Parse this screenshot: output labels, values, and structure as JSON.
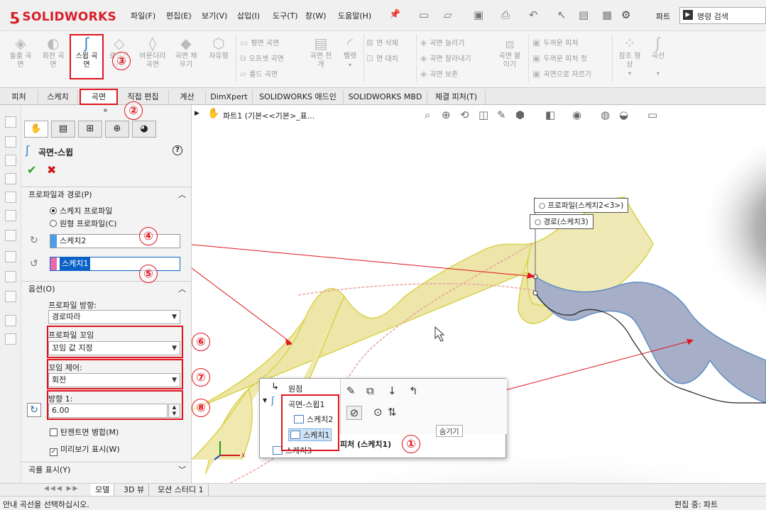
{
  "app": {
    "logo_text": "SOLIDWORKS",
    "part_label": "파트",
    "search_placeholder": "명령 검색"
  },
  "menu": [
    "파일(F)",
    "편집(E)",
    "보기(V)",
    "삽입(I)",
    "도구(T)",
    "창(W)",
    "도움말(H)"
  ],
  "ribbon": {
    "big": [
      {
        "label1": "돌출 곡",
        "label2": "면"
      },
      {
        "label1": "회전 곡",
        "label2": "면"
      },
      {
        "label1": "스윕 곡",
        "label2": "면"
      },
      {
        "label1": "로프트",
        "label2": "곡면"
      },
      {
        "label1": "바운더리",
        "label2": "곡면"
      },
      {
        "label1": "곡면 채",
        "label2": "우기"
      },
      {
        "label1": "자유형",
        "label2": ""
      }
    ],
    "col1": [
      "평면 곡면",
      "오프셋 곡면",
      "룰드 곡면"
    ],
    "col2a": {
      "label1": "곡면 전",
      "label2": "개"
    },
    "col2b": {
      "label1": "펠렛",
      "label2": ""
    },
    "col3": [
      "면 삭제",
      "면 대치"
    ],
    "col4": [
      "곡면 늘리기",
      "곡면 잘라내기",
      "곡면 보존"
    ],
    "col5": {
      "label1": "곡면 붙",
      "label2": "이기"
    },
    "col6": [
      "두꺼운 피처",
      "두꺼운 피처 컷",
      "곡면으로 자르기"
    ],
    "col7": {
      "label1": "참조 형",
      "label2": "상"
    },
    "col8": {
      "label1": "곡선",
      "label2": ""
    }
  },
  "tabs": [
    "피처",
    "스케치",
    "곡면",
    "직접 편집",
    "계산",
    "DimXpert",
    "SOLIDWORKS 애드인",
    "SOLIDWORKS MBD",
    "체결 피처(T)"
  ],
  "pm": {
    "title": "곡면-스윕",
    "section_profile": "프로파일과 경로(P)",
    "radio_sketch": "스케치 프로파일",
    "radio_circle": "원형 프로파일(C)",
    "profile_value": "스케치2",
    "path_value": "스케치1",
    "section_options": "옵션(O)",
    "orient_label": "프로파일 방향:",
    "orient_value": "경로따라",
    "twist_label": "프로파일 꼬임",
    "twist_value": "꼬임 값 지정",
    "twist_ctrl_label": "꼬임 제어:",
    "twist_ctrl_value": "회전",
    "direction_label": "방향 1:",
    "direction_value": "6.00",
    "merge_label": "탄젠트면 병합(M)",
    "preview_label": "미리보기 표시(W)",
    "section_curvature": "곡률 표시(Y)"
  },
  "viewport": {
    "tree_top": "파트1  (기본<<기본>_표...",
    "callout_profile": "프로파일(스케치2<3>)",
    "callout_path": "경로(스케치3)"
  },
  "popup": {
    "origin": "원점",
    "feature": "곡면-스윕1",
    "sketch2": "스케치2",
    "sketch1": "스케치1",
    "sketch3": "스케치3",
    "tooltip": "숨기기",
    "ctx_label": "피처 (스케치1)"
  },
  "markers": [
    "①",
    "②",
    "③",
    "④",
    "⑤",
    "⑥",
    "⑦",
    "⑧"
  ],
  "bottom_tabs": [
    "모델",
    "3D 뷰",
    "모션 스터디 1"
  ],
  "status": {
    "left": "안내 곡선을 선택하십시오.",
    "right": "편집 중: 파트"
  },
  "colors": {
    "accent_red": "#e0141e",
    "select_blue": "#0a62c7",
    "profile_swatch": "#4a9ee8",
    "path_swatch": "#e86ab0"
  }
}
